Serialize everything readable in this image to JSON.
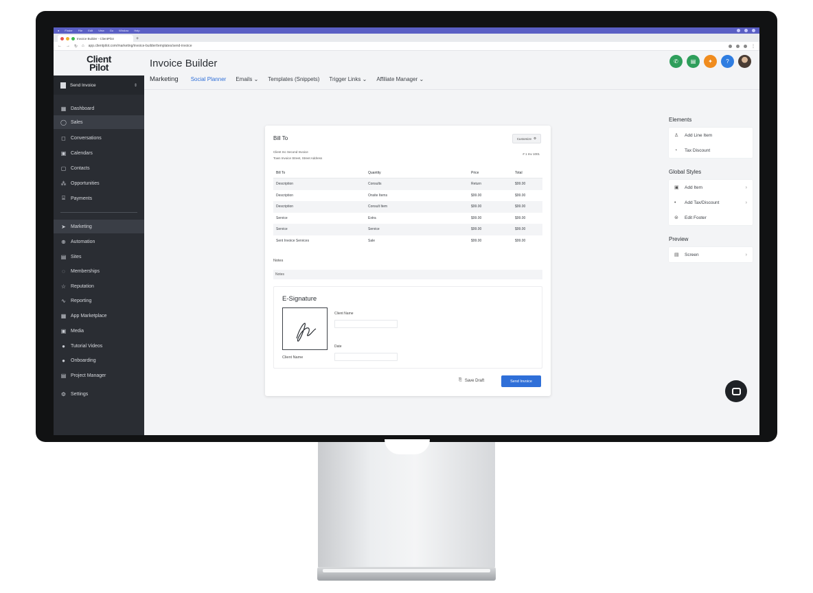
{
  "os_bar": {
    "items": [
      "Finder",
      "File",
      "Edit",
      "View",
      "Go",
      "Window",
      "Help"
    ]
  },
  "browser": {
    "tab_title": "Invoice Builder - ClientPilot",
    "url": "app.clientpilot.com/marketing/invoice-builder/templates/send-invoice"
  },
  "app": {
    "logo_line1": "Client",
    "logo_line2": "Pilot",
    "page_title": "Invoice Builder",
    "subnav": {
      "main": "Marketing",
      "items": [
        "Social Planner",
        "Emails",
        "Templates (Snippets)",
        "Trigger Links",
        "Affiliate Manager"
      ]
    },
    "top_icons": [
      {
        "name": "phone-icon",
        "color": "#2e9e5b",
        "glyph": "✆"
      },
      {
        "name": "messages-icon",
        "color": "#2e9e5b",
        "glyph": "▤"
      },
      {
        "name": "notification-icon",
        "color": "#f08c1e",
        "glyph": "✦"
      },
      {
        "name": "help-icon",
        "color": "#2f7de1",
        "glyph": "?"
      }
    ]
  },
  "sidebar": {
    "switcher": "Send Invoice",
    "items": [
      {
        "label": "Dashboard",
        "icon": "dashboard-icon"
      },
      {
        "label": "Sales",
        "icon": "sales-icon",
        "active": true
      },
      {
        "label": "Conversations",
        "icon": "conversations-icon"
      },
      {
        "label": "Calendars",
        "icon": "calendar-icon"
      },
      {
        "label": "Contacts",
        "icon": "contacts-icon"
      },
      {
        "label": "Opportunities",
        "icon": "opportunities-icon"
      },
      {
        "label": "Payments",
        "icon": "payments-icon"
      }
    ],
    "items2": [
      {
        "label": "Marketing",
        "icon": "marketing-icon",
        "active": true
      },
      {
        "label": "Automation",
        "icon": "automation-icon"
      },
      {
        "label": "Sites",
        "icon": "sites-icon"
      },
      {
        "label": "Memberships",
        "icon": "memberships-icon"
      },
      {
        "label": "Reputation",
        "icon": "reputation-icon"
      },
      {
        "label": "Reporting",
        "icon": "reporting-icon"
      },
      {
        "label": "App Marketplace",
        "icon": "marketplace-icon"
      },
      {
        "label": "Media",
        "icon": "media-icon"
      },
      {
        "label": "Tutorial Videos",
        "icon": "videos-icon"
      },
      {
        "label": "Onboarding",
        "icon": "onboarding-icon"
      },
      {
        "label": "Project Manager",
        "icon": "project-icon"
      }
    ],
    "settings": "Settings"
  },
  "invoice": {
    "bill_to": "Bill To",
    "customize": "Customize",
    "addr_line1": "Client Inc Second Invoice",
    "addr_line2": "Town Invoice Street, Street Address",
    "invoice_no": "# 1 Inv 1001",
    "headers": [
      "Bill To",
      "Quantity",
      "Price",
      "Total"
    ],
    "rows": [
      [
        "Description",
        "Consults",
        "Return",
        "$99.00"
      ],
      [
        "Description",
        "Onsite Items",
        "$99.00",
        "$99.00"
      ],
      [
        "Description",
        "Consult Item",
        "$99.00",
        "$99.00"
      ],
      [
        "Service",
        "Extra",
        "$99.00",
        "$99.00"
      ],
      [
        "Service",
        "Service",
        "$99.00",
        "$99.00"
      ],
      [
        "Sent Invoice Services",
        "Sale",
        "$99.00",
        "$99.00"
      ]
    ],
    "notes_label": "Notes",
    "notes_value": "Notes",
    "esig_title": "E-Signature",
    "client_name_label": "Client Name",
    "date_label": "Date",
    "sig_caption": "Client Name",
    "save_draft": "Save Draft",
    "send": "Send Invoice"
  },
  "right_panel": {
    "elements_title": "Elements",
    "elements": [
      {
        "label": "Add Line Item",
        "icon": "line-item-icon"
      },
      {
        "label": "Tax Discount",
        "icon": "tax-icon"
      }
    ],
    "global_title": "Global Styles",
    "global": [
      {
        "label": "Add Item",
        "icon": "add-item-icon"
      },
      {
        "label": "Add Tax/Discount",
        "icon": "discount-icon"
      },
      {
        "label": "Edit Footer",
        "icon": "footer-icon"
      }
    ],
    "preview_title": "Preview",
    "preview": [
      {
        "label": "Screen",
        "icon": "screen-icon"
      }
    ]
  }
}
